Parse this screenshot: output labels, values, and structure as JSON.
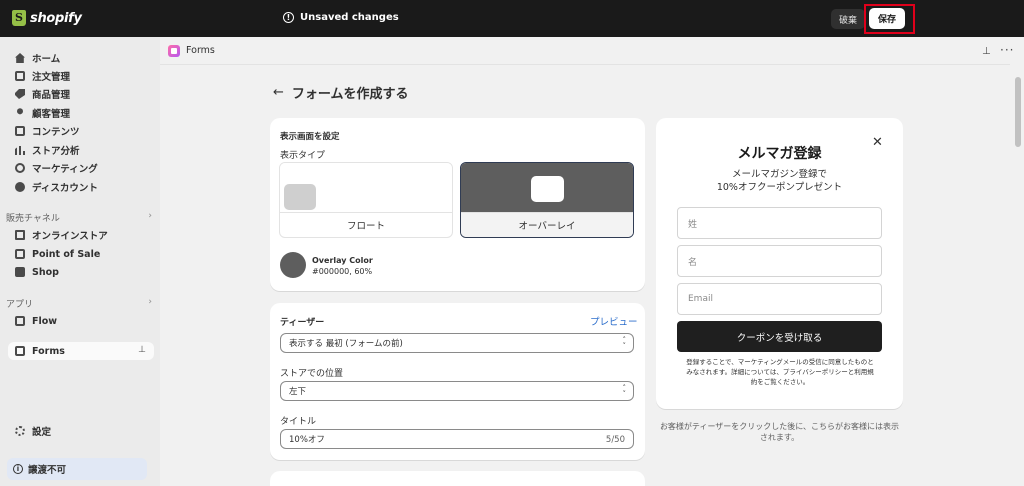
{
  "topbar": {
    "brand": "shopify",
    "unsaved": "Unsaved changes",
    "discard_label": "破棄",
    "save_label": "保存"
  },
  "sidebar": {
    "items": [
      {
        "label": "ホーム",
        "icon": "home-icon"
      },
      {
        "label": "注文管理",
        "icon": "orders-icon"
      },
      {
        "label": "商品管理",
        "icon": "tag-icon"
      },
      {
        "label": "顧客管理",
        "icon": "person-icon"
      },
      {
        "label": "コンテンツ",
        "icon": "content-icon"
      },
      {
        "label": "ストア分析",
        "icon": "bar-chart-icon"
      },
      {
        "label": "マーケティング",
        "icon": "target-icon"
      },
      {
        "label": "ディスカウント",
        "icon": "discount-icon"
      }
    ],
    "sales_channels": {
      "heading": "販売チャネル",
      "items": [
        {
          "label": "オンラインストア",
          "icon": "store-icon"
        },
        {
          "label": "Point of Sale",
          "icon": "pos-icon"
        },
        {
          "label": "Shop",
          "icon": "shop-icon"
        }
      ]
    },
    "apps": {
      "heading": "アプリ",
      "items": [
        {
          "label": "Flow",
          "icon": "flow-icon"
        }
      ]
    },
    "active_app": "Forms",
    "settings": "設定",
    "status": "譲渡不可"
  },
  "header": {
    "app_name": "Forms"
  },
  "page": {
    "title": "フォームを作成する"
  },
  "display": {
    "section_title": "表示画面を設定",
    "type_label": "表示タイプ",
    "float_label": "フロート",
    "overlay_label": "オーバーレイ",
    "overlay_color_name": "Overlay Color",
    "overlay_color_value": "#000000, 60%"
  },
  "teaser": {
    "title": "ティーザー",
    "preview_link": "プレビュー",
    "show_select": "表示する 最初 (フォームの前)",
    "position_label": "ストアでの位置",
    "position_value": "左下",
    "title_label": "タイトル",
    "title_value": "10%オフ",
    "title_count": "5/50"
  },
  "preview": {
    "title": "メルマガ登録",
    "subtitle_line1": "メールマガジン登録で",
    "subtitle_line2": "10%オフクーポンプレゼント",
    "last_name_placeholder": "姓",
    "first_name_placeholder": "名",
    "email_placeholder": "Email",
    "button": "クーポンを受け取る",
    "fine_print": "登録することで、マーケティングメールの受信に同意したものとみなされます。詳細については、プライバシーポリシーと利用規約をご覧ください。",
    "note": "お客様がティーザーをクリックした後に、こちらがお客様には表示されます。"
  },
  "colors": {
    "topbar": "#1a1a1a",
    "accent_link": "#2c6ecb",
    "highlight": "#e0001b",
    "overlay": "#5e5e5e"
  }
}
